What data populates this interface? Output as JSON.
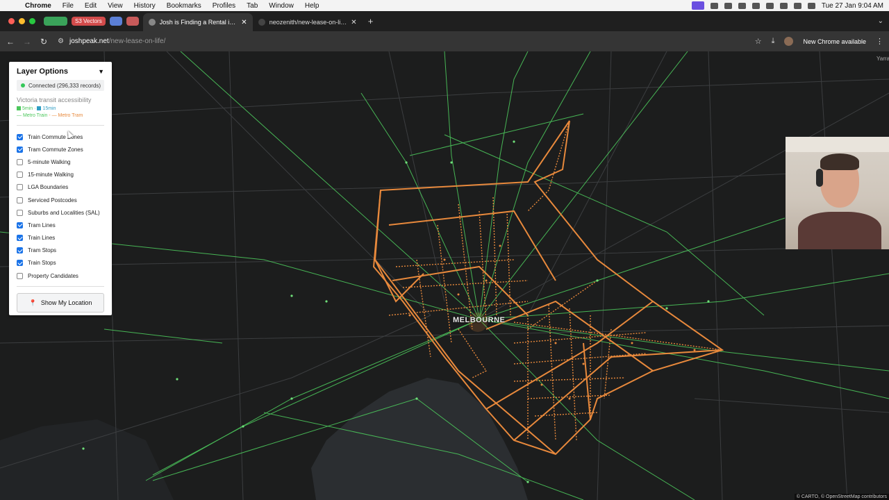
{
  "menubar": {
    "app_name": "Chrome",
    "menus": [
      "File",
      "Edit",
      "View",
      "History",
      "Bookmarks",
      "Profiles",
      "Tab",
      "Window",
      "Help"
    ],
    "clock": "Tue 27 Jan  9:04 AM"
  },
  "tabs": {
    "pill_vectors": "S3 Vectors",
    "active_tab_title": "Josh is Finding a Rental in Me",
    "second_tab_title": "neozenith/new-lease-on-life:"
  },
  "toolbar": {
    "url_host": "joshpeak.net",
    "url_path": "/new-lease-on-life/",
    "update_label": "New Chrome available"
  },
  "panel": {
    "title": "Layer Options",
    "toggle_glyph": "▼",
    "status": "Connected (296,333 records)",
    "subtitle": "Victoria transit accessibility",
    "legend_5min": "5min",
    "legend_15min": "15min",
    "legend_train": "— Metro Train",
    "legend_tram": "— Metro Tram",
    "legend_sep": " · ",
    "legend_sep2": " - ",
    "layers": [
      {
        "label": "Train Commute Zones",
        "checked": true
      },
      {
        "label": "Tram Commute Zones",
        "checked": true
      },
      {
        "label": "5-minute Walking",
        "checked": false
      },
      {
        "label": "15-minute Walking",
        "checked": false
      },
      {
        "label": "LGA Boundaries",
        "checked": false
      },
      {
        "label": "Serviced Postcodes",
        "checked": false
      },
      {
        "label": "Suburbs and Localities (SAL)",
        "checked": false
      },
      {
        "label": "Tram Lines",
        "checked": true
      },
      {
        "label": "Train Lines",
        "checked": true
      },
      {
        "label": "Tram Stops",
        "checked": true
      },
      {
        "label": "Train Stops",
        "checked": true
      },
      {
        "label": "Property Candidates",
        "checked": false
      }
    ],
    "location_button": "Show My Location"
  },
  "map": {
    "city_label": "MELBOURNE",
    "corner_label": "Yarra",
    "attribution": "© CARTO, © OpenStreetMap contributors",
    "colors": {
      "background": "#1c1d1d",
      "water": "#2b2e31",
      "roads": "#3c3e40",
      "train": "#4cc75c",
      "tram": "#e8893c"
    }
  }
}
